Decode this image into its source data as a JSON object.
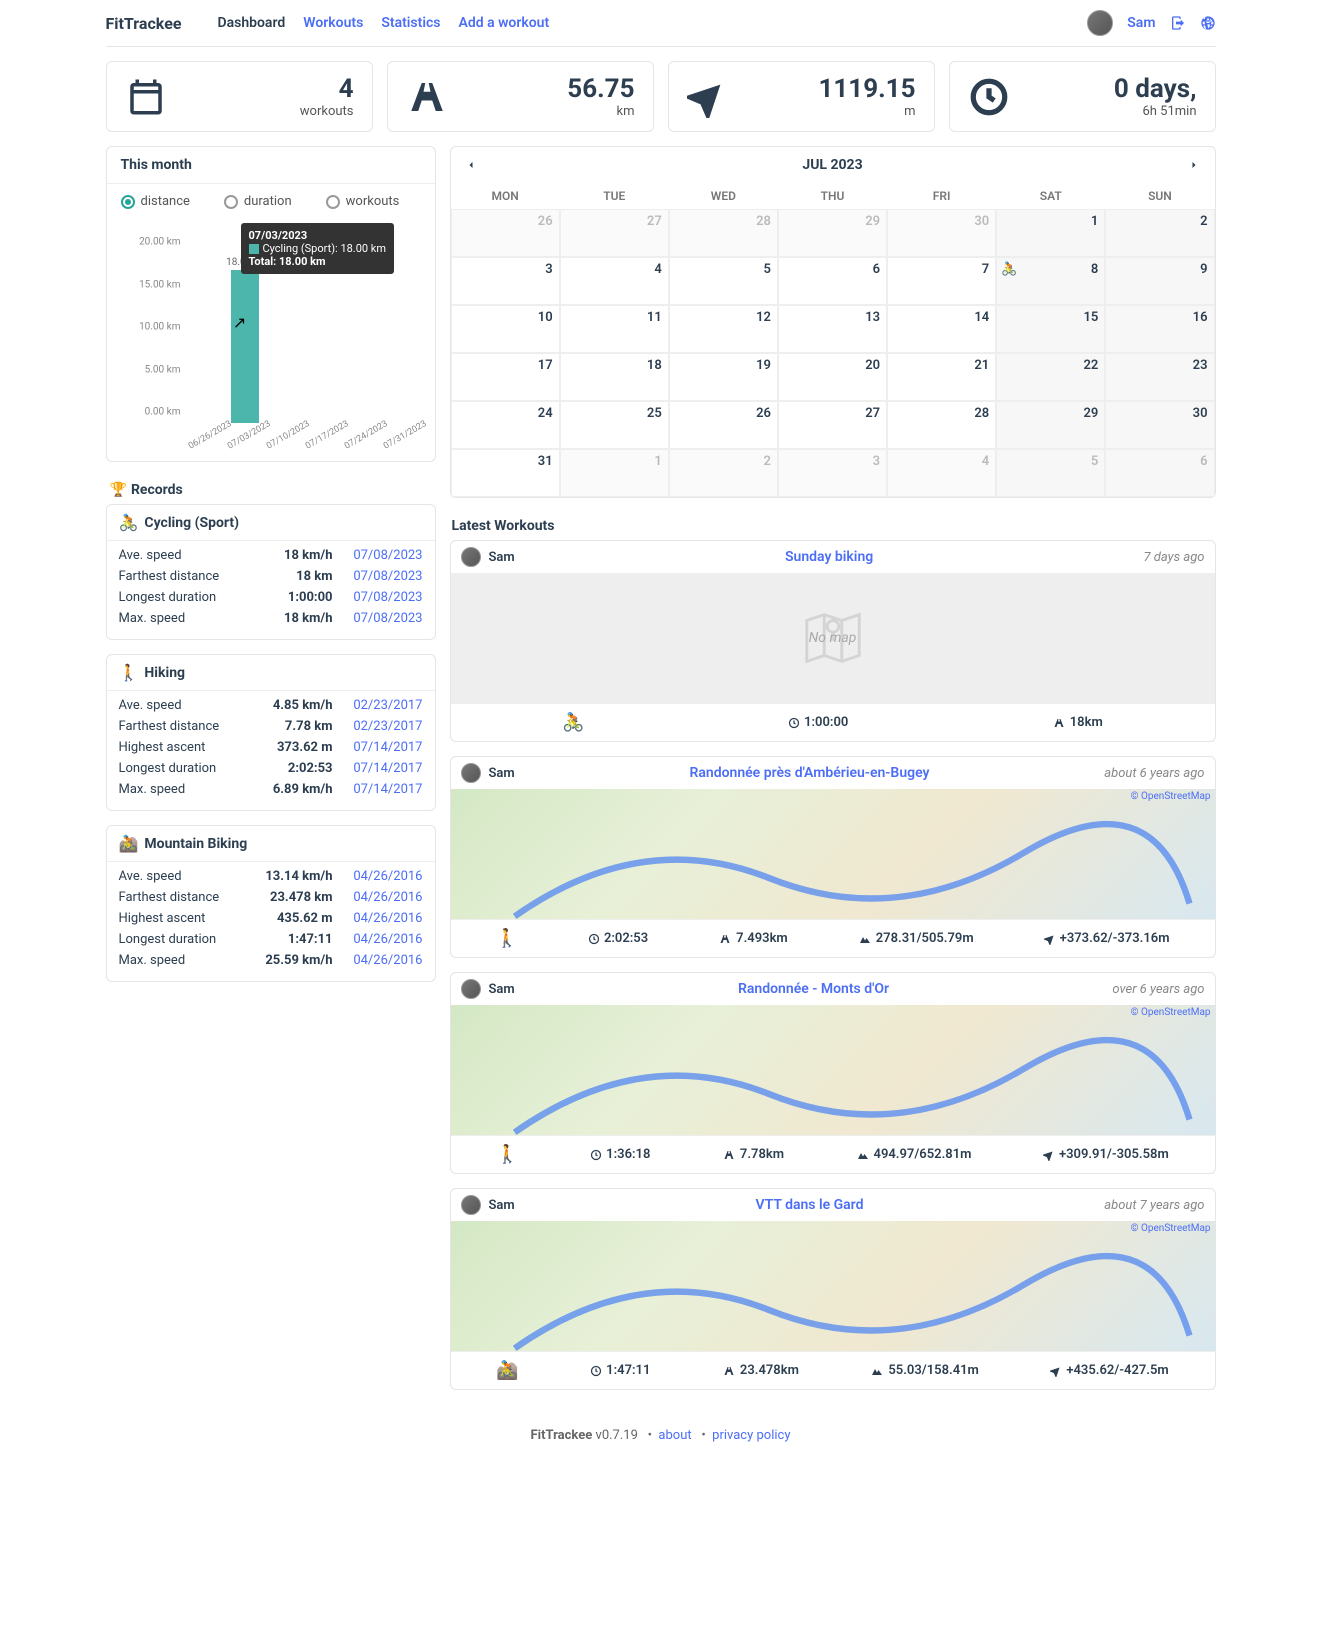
{
  "header": {
    "brand": "FitTrackee",
    "nav": [
      {
        "label": "Dashboard",
        "active": true
      },
      {
        "label": "Workouts",
        "active": false
      },
      {
        "label": "Statistics",
        "active": false
      },
      {
        "label": "Add a workout",
        "active": false
      }
    ],
    "user": "Sam"
  },
  "stats": [
    {
      "value": "4",
      "unit": "workouts",
      "icon": "calendar"
    },
    {
      "value": "56.75",
      "unit": "km",
      "icon": "road"
    },
    {
      "value": "1119.15",
      "unit": "m",
      "icon": "arrow"
    },
    {
      "value": "0 days,",
      "unit": "6h 51min",
      "icon": "clock"
    }
  ],
  "month_card": {
    "title": "This month",
    "modes": [
      {
        "label": "distance",
        "active": true
      },
      {
        "label": "duration",
        "active": false
      },
      {
        "label": "workouts",
        "active": false
      }
    ],
    "tooltip": {
      "date": "07/03/2023",
      "row": "Cycling (Sport): 18.00 km",
      "total": "Total: 18.00 km"
    },
    "bar_label": "18.00"
  },
  "chart_data": {
    "type": "bar",
    "categories": [
      "06/26/2023",
      "07/03/2023",
      "07/10/2023",
      "07/17/2023",
      "07/24/2023",
      "07/31/2023"
    ],
    "series": [
      {
        "name": "Cycling (Sport)",
        "values": [
          0,
          18.0,
          0,
          0,
          0,
          0
        ]
      }
    ],
    "ylabel": "km",
    "ylim": [
      0,
      20
    ],
    "yticks": [
      "0.00 km",
      "5.00 km",
      "10.00 km",
      "15.00 km",
      "20.00 km"
    ]
  },
  "records": {
    "title": "Records",
    "sports": [
      {
        "name": "Cycling (Sport)",
        "color": "#4db6ac",
        "icon": "bike",
        "rows": [
          {
            "label": "Ave. speed",
            "value": "18 km/h",
            "date": "07/08/2023"
          },
          {
            "label": "Farthest distance",
            "value": "18 km",
            "date": "07/08/2023"
          },
          {
            "label": "Longest duration",
            "value": "1:00:00",
            "date": "07/08/2023"
          },
          {
            "label": "Max. speed",
            "value": "18 km/h",
            "date": "07/08/2023"
          }
        ]
      },
      {
        "name": "Hiking",
        "color": "#c0392b",
        "icon": "hike",
        "rows": [
          {
            "label": "Ave. speed",
            "value": "4.85 km/h",
            "date": "02/23/2017"
          },
          {
            "label": "Farthest distance",
            "value": "7.78 km",
            "date": "02/23/2017"
          },
          {
            "label": "Highest ascent",
            "value": "373.62 m",
            "date": "07/14/2017"
          },
          {
            "label": "Longest duration",
            "value": "2:02:53",
            "date": "07/14/2017"
          },
          {
            "label": "Max. speed",
            "value": "6.89 km/h",
            "date": "07/14/2017"
          }
        ]
      },
      {
        "name": "Mountain Biking",
        "color": "#d4a017",
        "icon": "mtb",
        "rows": [
          {
            "label": "Ave. speed",
            "value": "13.14 km/h",
            "date": "04/26/2016"
          },
          {
            "label": "Farthest distance",
            "value": "23.478 km",
            "date": "04/26/2016"
          },
          {
            "label": "Highest ascent",
            "value": "435.62 m",
            "date": "04/26/2016"
          },
          {
            "label": "Longest duration",
            "value": "1:47:11",
            "date": "04/26/2016"
          },
          {
            "label": "Max. speed",
            "value": "25.59 km/h",
            "date": "04/26/2016"
          }
        ]
      }
    ]
  },
  "calendar": {
    "title": "JUL 2023",
    "days": [
      "MON",
      "TUE",
      "WED",
      "THU",
      "FRI",
      "SAT",
      "SUN"
    ],
    "cells": [
      {
        "n": 26,
        "other": true
      },
      {
        "n": 27,
        "other": true
      },
      {
        "n": 28,
        "other": true
      },
      {
        "n": 29,
        "other": true
      },
      {
        "n": 30,
        "other": true
      },
      {
        "n": 1,
        "weekend": true
      },
      {
        "n": 2,
        "weekend": true
      },
      {
        "n": 3
      },
      {
        "n": 4
      },
      {
        "n": 5
      },
      {
        "n": 6
      },
      {
        "n": 7
      },
      {
        "n": 8,
        "weekend": true,
        "workout": true
      },
      {
        "n": 9,
        "weekend": true
      },
      {
        "n": 10
      },
      {
        "n": 11
      },
      {
        "n": 12
      },
      {
        "n": 13
      },
      {
        "n": 14
      },
      {
        "n": 15,
        "weekend": true
      },
      {
        "n": 16,
        "weekend": true
      },
      {
        "n": 17
      },
      {
        "n": 18
      },
      {
        "n": 19
      },
      {
        "n": 20
      },
      {
        "n": 21
      },
      {
        "n": 22,
        "weekend": true
      },
      {
        "n": 23,
        "weekend": true
      },
      {
        "n": 24
      },
      {
        "n": 25
      },
      {
        "n": 26
      },
      {
        "n": 27
      },
      {
        "n": 28
      },
      {
        "n": 29,
        "weekend": true
      },
      {
        "n": 30,
        "weekend": true
      },
      {
        "n": 31
      },
      {
        "n": 1,
        "other": true
      },
      {
        "n": 2,
        "other": true
      },
      {
        "n": 3,
        "other": true
      },
      {
        "n": 4,
        "other": true
      },
      {
        "n": 5,
        "other": true,
        "weekend": true
      },
      {
        "n": 6,
        "other": true,
        "weekend": true
      }
    ]
  },
  "latest": {
    "title": "Latest Workouts",
    "items": [
      {
        "user": "Sam",
        "title": "Sunday biking",
        "time": "7 days ago",
        "map": false,
        "sport_color": "#4db6ac",
        "nomap": "No map",
        "foot": [
          {
            "icon": "clock",
            "text": "1:00:00"
          },
          {
            "icon": "road",
            "text": "18km"
          }
        ]
      },
      {
        "user": "Sam",
        "title": "Randonnée près d'Ambérieu-en-Bugey",
        "time": "about 6 years ago",
        "map": true,
        "sport_color": "#c0392b",
        "credit": "© OpenStreetMap",
        "foot": [
          {
            "icon": "clock",
            "text": "2:02:53"
          },
          {
            "icon": "road",
            "text": "7.493km"
          },
          {
            "icon": "mtn",
            "text": "278.31/505.79m"
          },
          {
            "icon": "arrow",
            "text": "+373.62/-373.16m"
          }
        ]
      },
      {
        "user": "Sam",
        "title": "Randonnée - Monts d'Or",
        "time": "over 6 years ago",
        "map": true,
        "sport_color": "#c0392b",
        "credit": "© OpenStreetMap",
        "foot": [
          {
            "icon": "clock",
            "text": "1:36:18"
          },
          {
            "icon": "road",
            "text": "7.78km"
          },
          {
            "icon": "mtn",
            "text": "494.97/652.81m"
          },
          {
            "icon": "arrow",
            "text": "+309.91/-305.58m"
          }
        ]
      },
      {
        "user": "Sam",
        "title": "VTT dans le Gard",
        "time": "about 7 years ago",
        "map": true,
        "sport_color": "#d4a017",
        "credit": "© OpenStreetMap",
        "foot": [
          {
            "icon": "clock",
            "text": "1:47:11"
          },
          {
            "icon": "road",
            "text": "23.478km"
          },
          {
            "icon": "mtn",
            "text": "55.03/158.41m"
          },
          {
            "icon": "arrow",
            "text": "+435.62/-427.5m"
          }
        ]
      }
    ]
  },
  "footer": {
    "brand": "FitTrackee",
    "version": "v0.7.19",
    "links": [
      "about",
      "privacy policy"
    ]
  }
}
